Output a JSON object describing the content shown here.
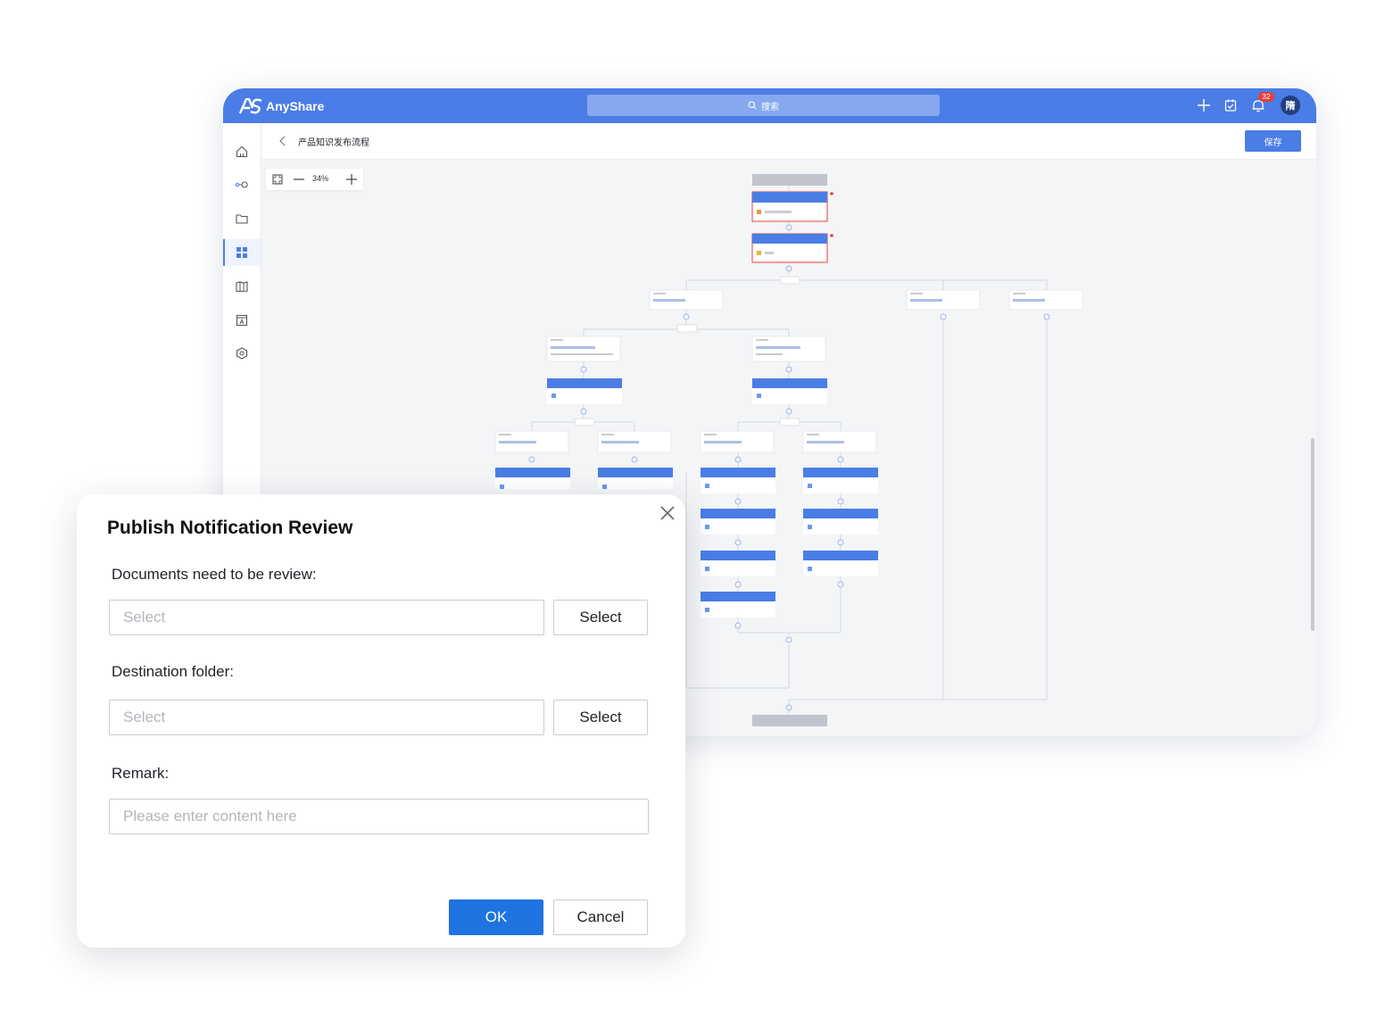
{
  "app": {
    "brand_name": "AnyShare",
    "search_placeholder": "搜索",
    "notification_count": "32",
    "avatar_initial": "隋"
  },
  "sidebar": {
    "items": [
      {
        "icon": "home-icon"
      },
      {
        "icon": "workflow-icon"
      },
      {
        "icon": "folder-icon"
      },
      {
        "icon": "apps-grid-icon",
        "active": true
      },
      {
        "icon": "book-icon"
      },
      {
        "icon": "template-icon"
      },
      {
        "icon": "settings-cube-icon"
      }
    ]
  },
  "header": {
    "title": "产品知识发布流程",
    "save_label": "保存"
  },
  "canvas": {
    "zoom_level": "34%"
  },
  "dialog": {
    "title": "Publish Notification Review",
    "documents_label": "Documents need to be review:",
    "documents_placeholder": "Select",
    "documents_button": "Select",
    "destination_label": "Destination folder:",
    "destination_placeholder": "Select",
    "destination_button": "Select",
    "remark_label": "Remark:",
    "remark_placeholder": "Please enter content here",
    "ok_label": "OK",
    "cancel_label": "Cancel"
  },
  "colors": {
    "topbar": "#4a7de5",
    "primary_button": "#1f73e0",
    "flow_node_header": "#4a7de5",
    "flow_node_error": "#e8403a"
  }
}
